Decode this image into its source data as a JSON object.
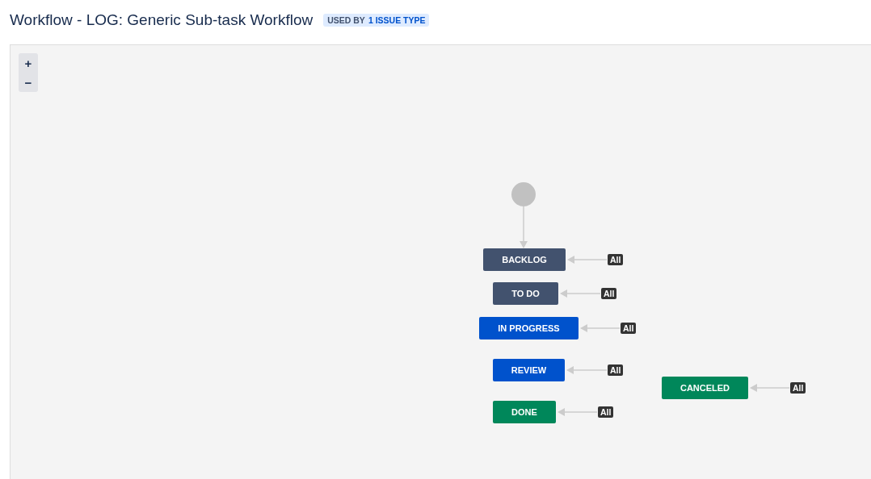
{
  "header": {
    "title": "Workflow - LOG: Generic Sub-task Workflow",
    "badge": {
      "prefix": "USED BY",
      "count": "1 ISSUE TYPE"
    }
  },
  "zoom_controls": [
    "+",
    "−"
  ],
  "statuses": [
    {
      "name": "BACKLOG",
      "color": "#42526e",
      "transition": "All"
    },
    {
      "name": "TO DO",
      "color": "#42526e",
      "transition": "All"
    },
    {
      "name": "IN PROGRESS",
      "color": "#0052cc",
      "transition": "All"
    },
    {
      "name": "REVIEW",
      "color": "#0052cc",
      "transition": "All"
    },
    {
      "name": "CANCELED",
      "color": "#00875a",
      "transition": "All"
    },
    {
      "name": "DONE",
      "color": "#00875a",
      "transition": "All"
    }
  ]
}
